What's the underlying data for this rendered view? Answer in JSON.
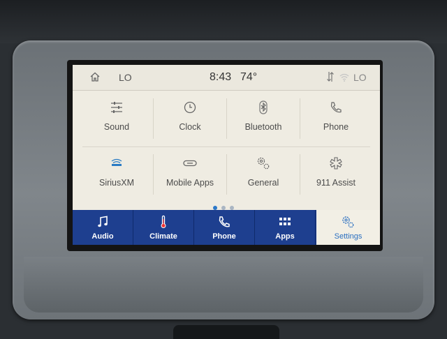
{
  "status_bar": {
    "left_label": "LO",
    "time": "8:43",
    "temperature": "74°",
    "right_label": "LO"
  },
  "settings_grid": {
    "items": [
      {
        "label": "Sound",
        "icon": "sliders-icon"
      },
      {
        "label": "Clock",
        "icon": "clock-icon"
      },
      {
        "label": "Bluetooth",
        "icon": "bluetooth-icon"
      },
      {
        "label": "Phone",
        "icon": "phone-icon"
      },
      {
        "label": "SiriusXM",
        "icon": "siriusxm-icon"
      },
      {
        "label": "Mobile Apps",
        "icon": "link-icon"
      },
      {
        "label": "General",
        "icon": "gears-icon"
      },
      {
        "label": "911 Assist",
        "icon": "assist-icon"
      }
    ]
  },
  "pager": {
    "pages": 3,
    "current": 1
  },
  "bottom_nav": {
    "items": [
      {
        "label": "Audio",
        "icon": "music-note-icon"
      },
      {
        "label": "Climate",
        "icon": "thermometer-icon"
      },
      {
        "label": "Phone",
        "icon": "phone-icon"
      },
      {
        "label": "Apps",
        "icon": "apps-grid-icon"
      },
      {
        "label": "Settings",
        "icon": "gears-icon"
      }
    ],
    "active": "Settings"
  },
  "colors": {
    "nav_background": "#1e3f8f",
    "screen_background": "#efece2",
    "accent": "#2a6fc0"
  }
}
